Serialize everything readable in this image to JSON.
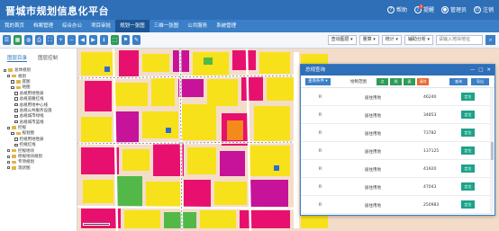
{
  "app": {
    "title": "晋城市规划信息化平台"
  },
  "header_actions": [
    {
      "label": "帮助",
      "icon": "help-icon"
    },
    {
      "label": "提醒",
      "icon": "bell-icon",
      "badge": "2"
    },
    {
      "label": "管理员",
      "icon": "user-icon"
    },
    {
      "label": "注销",
      "icon": "power-icon"
    }
  ],
  "nav": [
    {
      "label": "我的首页",
      "active": false
    },
    {
      "label": "档案管理",
      "active": false
    },
    {
      "label": "综合办公",
      "active": false
    },
    {
      "label": "项目审批",
      "active": false
    },
    {
      "label": "规划一张图",
      "active": true
    },
    {
      "label": "三维一张图",
      "active": false
    },
    {
      "label": "公共服务",
      "active": false
    },
    {
      "label": "系统管理",
      "active": false
    }
  ],
  "toolbar": {
    "menus": [
      "查询图层 ▾",
      "量算 ▾",
      "统计 ▾",
      "辅助分析 ▾"
    ],
    "search_placeholder": "请输入地块地址",
    "search_button": "⌕"
  },
  "sidebar": {
    "tabs": [
      {
        "label": "图层目录",
        "active": true
      },
      {
        "label": "图层控制",
        "active": false
      }
    ],
    "tree": [
      {
        "label": "总体规划",
        "level": 0
      },
      {
        "label": "规划",
        "level": 1
      },
      {
        "label": "底图",
        "level": 2
      },
      {
        "label": "地图",
        "level": 2
      },
      {
        "label": "总规用地性质",
        "level": 3
      },
      {
        "label": "总规道路红线",
        "level": 3
      },
      {
        "label": "总规用地中心线",
        "level": 3
      },
      {
        "label": "总规公共服务设施",
        "level": 3
      },
      {
        "label": "总规城市绿线",
        "level": 3
      },
      {
        "label": "总规城市蓝线",
        "level": 3
      },
      {
        "label": "控规",
        "level": 1
      },
      {
        "label": "规划图",
        "level": 2
      },
      {
        "label": "控规用地性质",
        "level": 3
      },
      {
        "label": "控规红线",
        "level": 3
      },
      {
        "label": "控规地块",
        "level": 1
      },
      {
        "label": "修规地块规划",
        "level": 1
      },
      {
        "label": "专项规划",
        "level": 1
      },
      {
        "label": "现状图",
        "level": 1
      }
    ]
  },
  "panel": {
    "title": "总规查询",
    "controls": [
      "—",
      "□",
      "✕"
    ],
    "filter_select": "查询条件 ▾",
    "filter_label": "绘制范围",
    "draw_buttons": [
      {
        "label": "点",
        "color": "#2e9b5a"
      },
      {
        "label": "线",
        "color": "#2e9b5a"
      },
      {
        "label": "面",
        "color": "#2e9b5a"
      },
      {
        "label": "清除",
        "color": "#e8692f"
      }
    ],
    "action_buttons": [
      "查询",
      "导出"
    ],
    "rows": [
      {
        "code": "R",
        "type": "居住用地",
        "area": "46240",
        "action": "定位"
      },
      {
        "code": "R",
        "type": "居住用地",
        "area": "34853",
        "action": "定位"
      },
      {
        "code": "R",
        "type": "居住用地",
        "area": "73782",
        "action": "定位"
      },
      {
        "code": "R",
        "type": "居住用地",
        "area": "137125",
        "action": "定位"
      },
      {
        "code": "R",
        "type": "居住用地",
        "area": "41920",
        "action": "定位"
      },
      {
        "code": "R",
        "type": "居住用地",
        "area": "47043",
        "action": "定位"
      },
      {
        "code": "R",
        "type": "居住用地",
        "area": "250983",
        "action": "定位"
      }
    ]
  },
  "colors": {
    "header": "#2e6fb8",
    "nav_active": "#1b5595",
    "locate_button": "#1ca388",
    "residential": "#f7e11a",
    "commercial": "#e8106e",
    "green": "#52b847",
    "public": "#c7129a"
  }
}
